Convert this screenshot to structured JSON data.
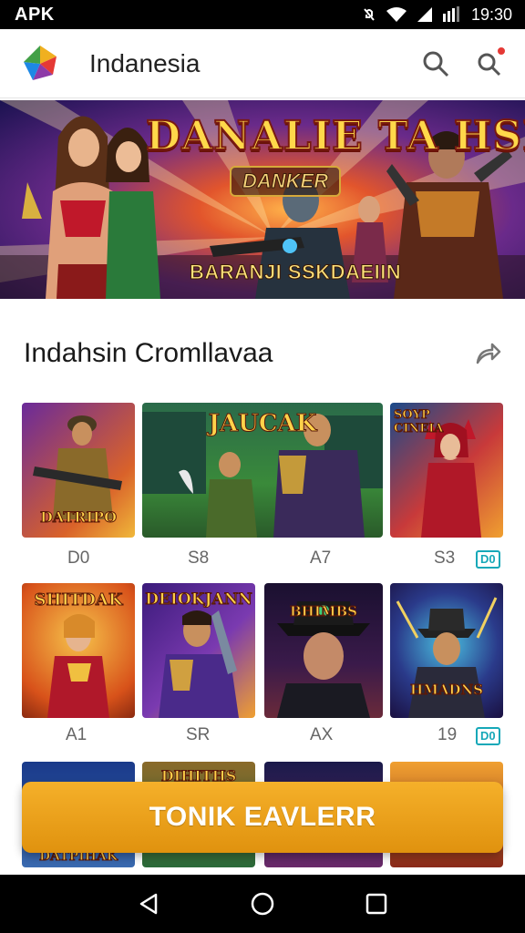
{
  "status_bar": {
    "left": "APK",
    "time": "19:30"
  },
  "app_bar": {
    "title": "Indanesia",
    "icons": [
      "app-logo-icon",
      "search-icon",
      "notification-search-icon"
    ]
  },
  "banner": {
    "title": "DANALIE TA HSIMS!",
    "subtitle": "DANKER",
    "caption": "BARANJI SSKDAEIIN"
  },
  "section": {
    "title": "Indahsin Cromllavaa",
    "action_icon": "share-icon"
  },
  "rows": [
    {
      "tiles": [
        {
          "title": "DATRIPO",
          "label": "D0"
        },
        {
          "title": "JAUCAK",
          "label": "S8"
        },
        {
          "title": "",
          "label": "A7"
        },
        {
          "title": "SOYP CINEIA",
          "label": "S3",
          "badge": "D0"
        }
      ]
    },
    {
      "tiles": [
        {
          "title": "SHITDAK",
          "label": "A1"
        },
        {
          "title": "DEIOKJANN",
          "label": "SR"
        },
        {
          "title": "BHIMBS",
          "label": "AX"
        },
        {
          "title": "HMADNS",
          "label": "19",
          "badge": "D0"
        }
      ]
    },
    {
      "tiles": [
        {
          "title": "DATPIHAK"
        },
        {
          "title": "DIHITHS"
        },
        {
          "title": ""
        },
        {
          "title": ""
        }
      ]
    }
  ],
  "cta": {
    "label": "TONIK EAVLERR"
  },
  "nav": {
    "icons": [
      "back-icon",
      "home-icon",
      "recents-icon"
    ]
  },
  "colors": {
    "accent": "#f0a21a",
    "badge": "#16a8b8",
    "status_bg": "#000000"
  }
}
